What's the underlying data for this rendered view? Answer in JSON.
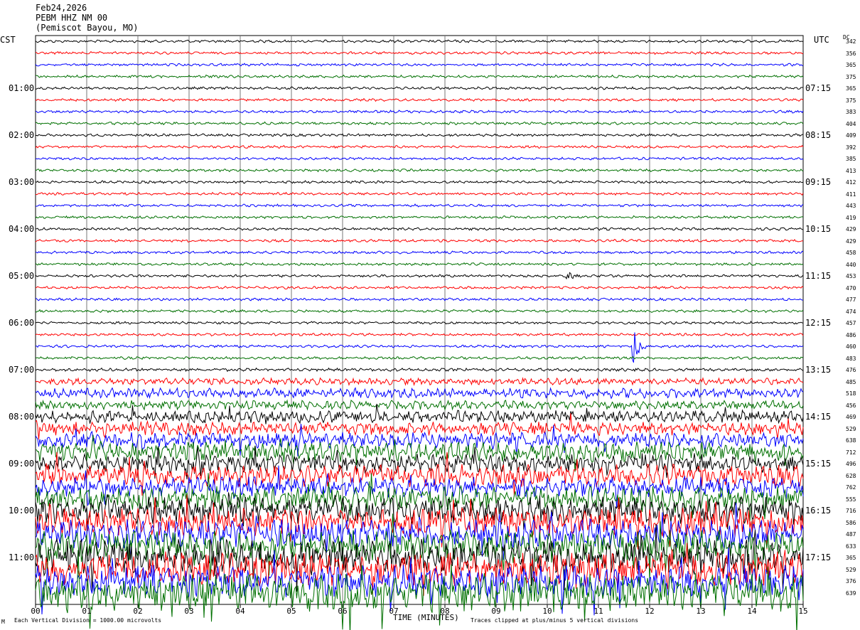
{
  "header": {
    "date": "Feb24,2026",
    "station": "PEBM HHZ NM 00",
    "location": "(Pemiscot Bayou, MO)"
  },
  "left_axis_label": "CST",
  "right_axis_label": "UTC",
  "dc_header": "DC",
  "chart_data": {
    "type": "line",
    "description_kind": "helicorder",
    "xlabel": "TIME (MINUTES)",
    "x_ticks": [
      "00",
      "01",
      "02",
      "03",
      "04",
      "05",
      "06",
      "07",
      "08",
      "09",
      "10",
      "11",
      "12",
      "13",
      "14",
      "15"
    ],
    "xlim": [
      0,
      15
    ],
    "trace_colors": [
      "#000000",
      "#ff0000",
      "#0000ff",
      "#007000"
    ],
    "row_count": 48,
    "left_time_labels": [
      "01:00",
      "02:00",
      "03:00",
      "04:00",
      "05:00",
      "06:00",
      "07:00",
      "08:00",
      "09:00",
      "10:00",
      "11:00"
    ],
    "right_time_labels": [
      "07:15",
      "08:15",
      "09:15",
      "10:15",
      "11:15",
      "12:15",
      "13:15",
      "14:15",
      "15:15",
      "16:15",
      "17:15"
    ],
    "dc_offsets": [
      342,
      356,
      365,
      375,
      365,
      375,
      383,
      404,
      409,
      392,
      385,
      413,
      412,
      411,
      443,
      419,
      429,
      429,
      458,
      440,
      453,
      470,
      477,
      474,
      457,
      486,
      460,
      483,
      476,
      485,
      518,
      456,
      469,
      529,
      638,
      712,
      496,
      628,
      762,
      555,
      716,
      586,
      487,
      633,
      365,
      529,
      376,
      639
    ],
    "noise_amplitude": [
      0.12,
      0.12,
      0.12,
      0.12,
      0.12,
      0.12,
      0.12,
      0.12,
      0.12,
      0.12,
      0.12,
      0.12,
      0.12,
      0.12,
      0.12,
      0.12,
      0.12,
      0.12,
      0.12,
      0.12,
      0.12,
      0.12,
      0.12,
      0.12,
      0.12,
      0.12,
      0.12,
      0.12,
      0.14,
      0.3,
      0.45,
      0.4,
      0.55,
      0.6,
      0.7,
      0.9,
      0.8,
      1.0,
      0.9,
      1.1,
      1.2,
      1.3,
      1.3,
      1.4,
      1.6,
      1.5,
      1.4,
      1.7
    ],
    "events": [
      {
        "row": 20,
        "minute": 10.4,
        "amplitude": 0.7
      },
      {
        "row": 26,
        "minute": 11.7,
        "amplitude": 1.8
      }
    ],
    "footer_left": "Each Vertical Division = 1000.00 microvolts",
    "footer_right": "Traces clipped at plus/minus 5 vertical divisions",
    "corner_mark": "M"
  }
}
